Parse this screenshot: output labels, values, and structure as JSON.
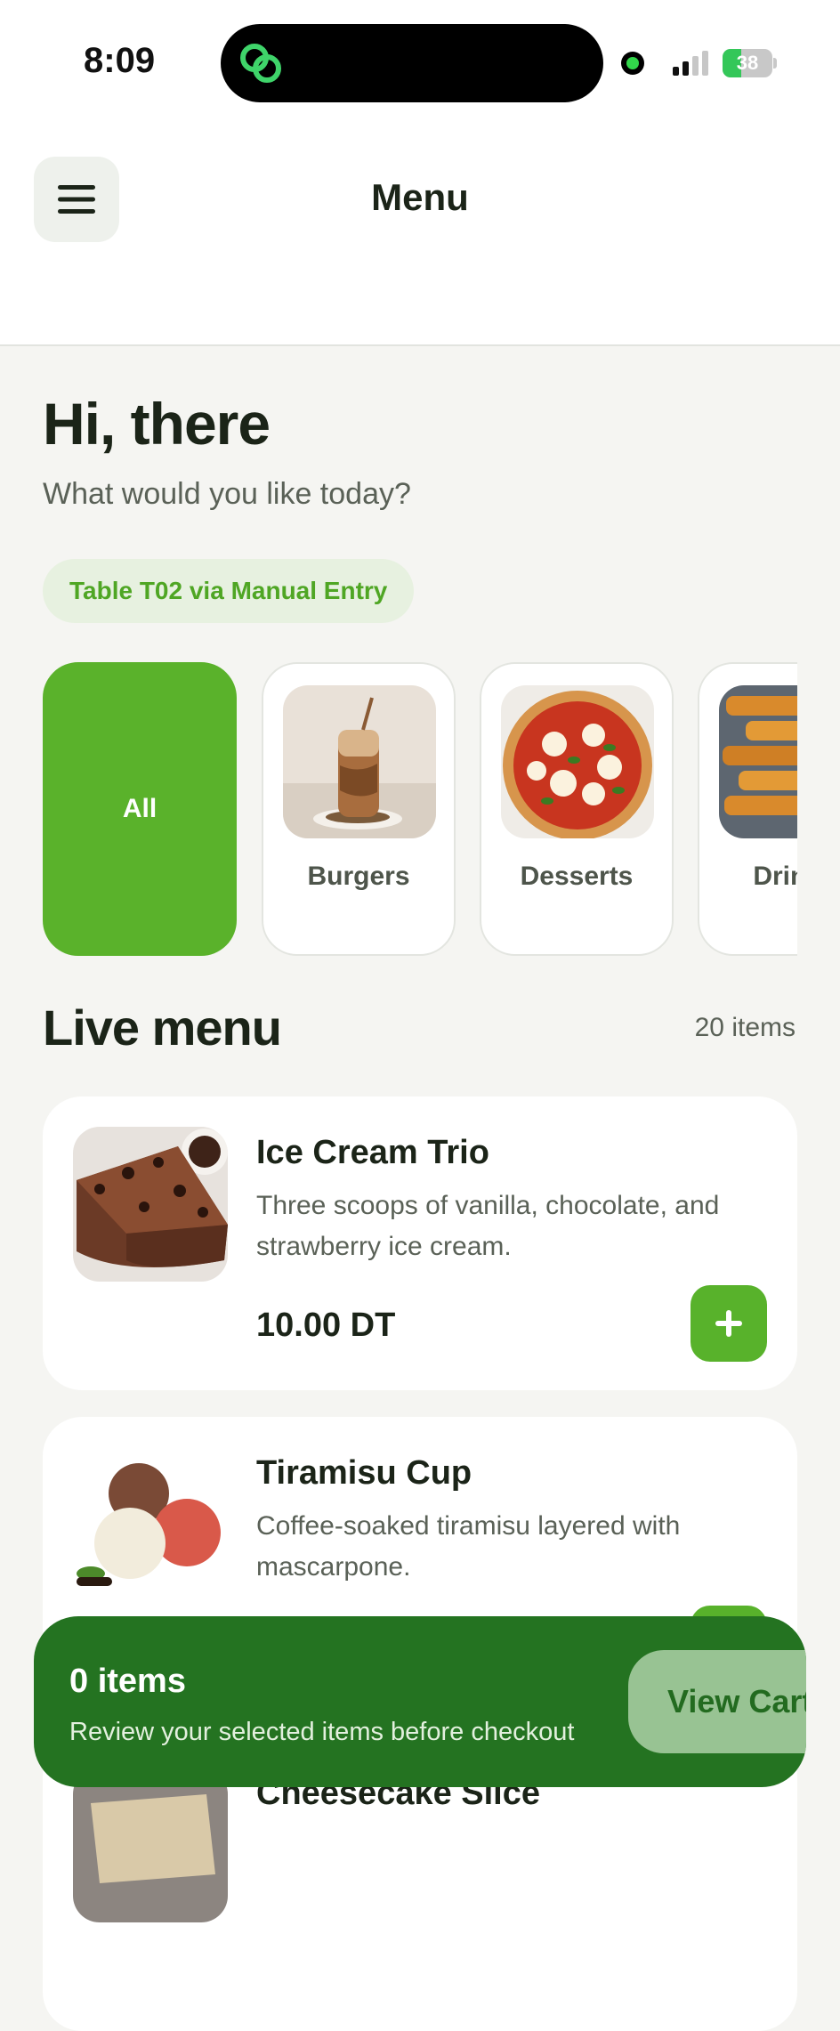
{
  "status_bar": {
    "time": "8:09",
    "battery": "38",
    "battery_level": 0.38
  },
  "header": {
    "title": "Menu",
    "menu_icon": "hamburger-icon"
  },
  "greeting": {
    "title": "Hi, there",
    "subtitle": "What would you like today?"
  },
  "table": {
    "label": "Table T02 via Manual Entry"
  },
  "categories": [
    {
      "label": "All",
      "active": true
    },
    {
      "label": "Burgers",
      "image": "iced-coffee-drink-photo"
    },
    {
      "label": "Desserts",
      "image": "pizza-photo"
    },
    {
      "label": "Drinks",
      "image": "fried-sticks-photo"
    }
  ],
  "live_menu": {
    "title": "Live menu",
    "count": "20 items"
  },
  "items": [
    {
      "name": "Ice Cream Trio",
      "description": "Three scoops of vanilla, chocolate, and strawberry ice cream.",
      "price": "10.00 DT",
      "image": "chocolate-cake-slice-photo"
    },
    {
      "name": "Tiramisu Cup",
      "description": "Coffee-soaked tiramisu layered with mascarpone.",
      "price": "",
      "image": "ice-cream-scoops-photo"
    },
    {
      "name": "Cheesecake Slice",
      "description": "",
      "price": "",
      "image": "cheesecake-photo"
    }
  ],
  "cart": {
    "count": "0 items",
    "subtitle": "Review your selected items before checkout",
    "button": "View Cart"
  },
  "colors": {
    "accent": "#5ab22b",
    "cart_bar": "#247321",
    "background": "#f5f5f2"
  }
}
